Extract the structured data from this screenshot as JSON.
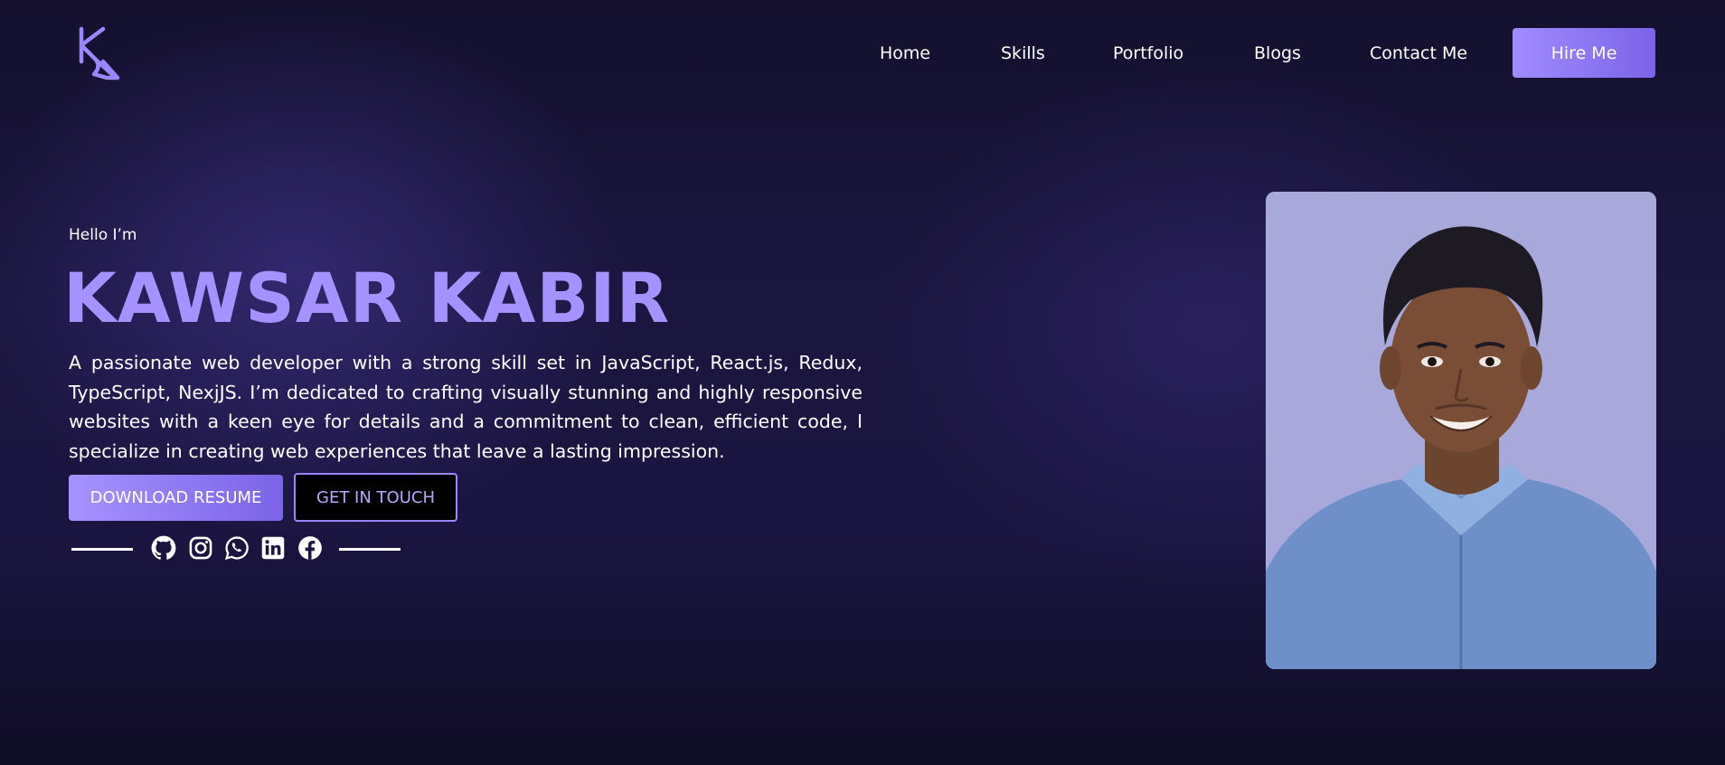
{
  "header": {
    "nav": [
      {
        "label": "Home"
      },
      {
        "label": "Skills"
      },
      {
        "label": "Portfolio"
      },
      {
        "label": "Blogs"
      },
      {
        "label": "Contact Me"
      }
    ],
    "hire_label": "Hire Me"
  },
  "hero": {
    "greeting": "Hello I’m",
    "name": "KAWSAR KABIR",
    "bio": "A passionate web developer with a strong skill set in JavaScript, React.js, Redux, TypeScript, NexjJS. I’m dedicated to crafting visually stunning and highly responsive websites with a keen eye for details and a commitment to clean, efficient code, I specialize in creating web experiences that leave a lasting impression.",
    "download_label": "DOWNLOAD RESUME",
    "touch_label": "GET IN TOUCH",
    "socials": [
      "github-icon",
      "instagram-icon",
      "whatsapp-icon",
      "linkedin-icon",
      "facebook-icon"
    ]
  },
  "colors": {
    "accent": "#a592ff",
    "button_gradient_start": "#a693ff",
    "button_gradient_end": "#7c63e8",
    "background": "#1b1640",
    "portrait_bg": "#a6a6d8"
  }
}
